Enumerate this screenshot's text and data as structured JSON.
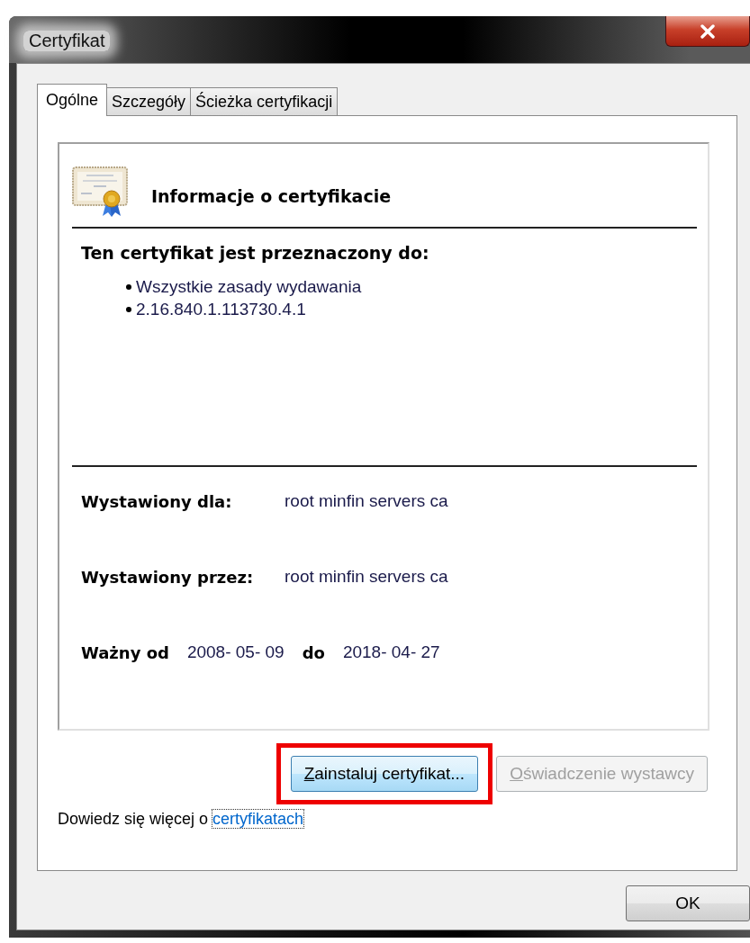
{
  "window": {
    "title": "Certyfikat"
  },
  "tabs": [
    {
      "label": "Ogólne",
      "selected": true
    },
    {
      "label": "Szczegóły",
      "selected": false
    },
    {
      "label": "Ścieżka certyfikacji",
      "selected": false
    }
  ],
  "info": {
    "heading": "Informacje o certyfikacie",
    "purpose_title": "Ten certyfikat jest przeznaczony do:",
    "purposes": [
      "Wszystkie zasady wydawania",
      "2.16.840.1.113730.4.1"
    ],
    "issued_to": {
      "label": "Wystawiony dla:",
      "value": "root minfin servers ca"
    },
    "issued_by": {
      "label": "Wystawiony przez:",
      "value": "root minfin servers ca"
    },
    "validity": {
      "from_label": "Ważny od",
      "from": "2008- 05- 09",
      "to_label": "do",
      "to": "2018- 04- 27"
    }
  },
  "buttons": [
    {
      "label": "Zainstaluj certyfikat...",
      "disabled": false,
      "highlighted": true
    },
    {
      "label": "Oświadczenie wystawcy",
      "disabled": true,
      "highlighted": false
    }
  ],
  "learn_more": {
    "text": "Dowiedz się więcej o ",
    "link": "certyfikatach"
  },
  "ok_button": {
    "label": "OK"
  }
}
